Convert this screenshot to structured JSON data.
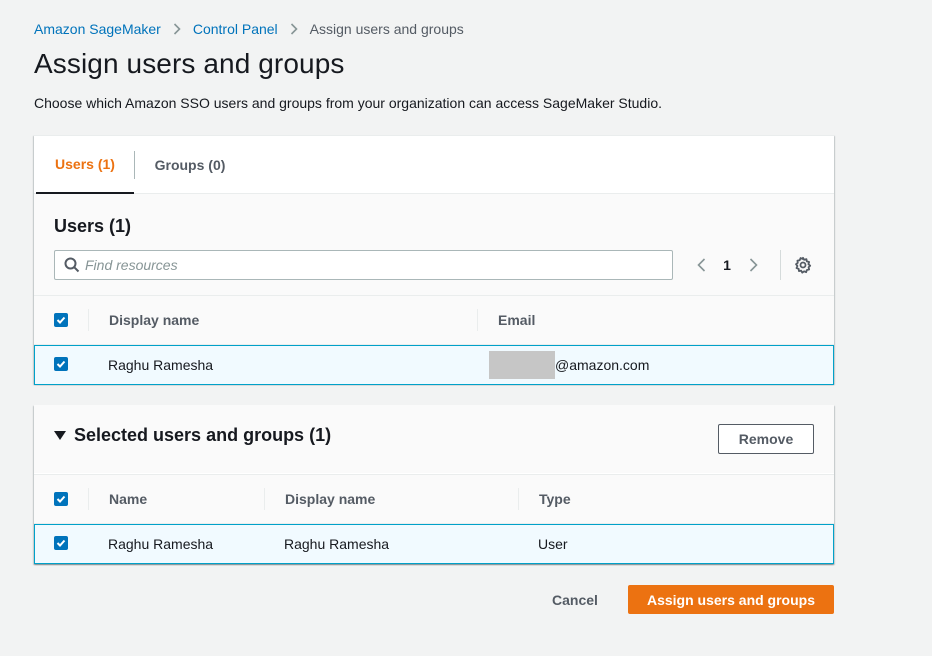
{
  "breadcrumb": {
    "items": [
      "Amazon SageMaker",
      "Control Panel"
    ],
    "current": "Assign users and groups"
  },
  "page": {
    "title": "Assign users and groups",
    "description": "Choose which Amazon SSO users and groups from your organization can access SageMaker Studio."
  },
  "tabs": [
    {
      "label": "Users (1)",
      "active": true
    },
    {
      "label": "Groups (0)",
      "active": false
    }
  ],
  "users_table": {
    "title": "Users (1)",
    "search_placeholder": "Find resources",
    "page_number": "1",
    "columns": [
      "Display name",
      "Email"
    ],
    "rows": [
      {
        "display_name": "Raghu Ramesha",
        "email": "@amazon.com",
        "selected": true
      }
    ]
  },
  "selected_section": {
    "title": "Selected users and groups (1)",
    "remove_label": "Remove",
    "columns": [
      "Name",
      "Display name",
      "Type"
    ],
    "rows": [
      {
        "name": "Raghu Ramesha",
        "display_name": "Raghu Ramesha",
        "type": "User",
        "selected": true
      }
    ]
  },
  "footer": {
    "cancel_label": "Cancel",
    "submit_label": "Assign users and groups"
  },
  "colors": {
    "accent": "#ec7211",
    "link": "#0073bb",
    "selected_row_border": "#00a1c9",
    "selected_row_bg": "#f1faff"
  },
  "icons": [
    "chevron-right-icon",
    "search-icon",
    "chevron-left-icon",
    "gear-icon",
    "checkbox-checked-icon",
    "caret-down-icon"
  ]
}
